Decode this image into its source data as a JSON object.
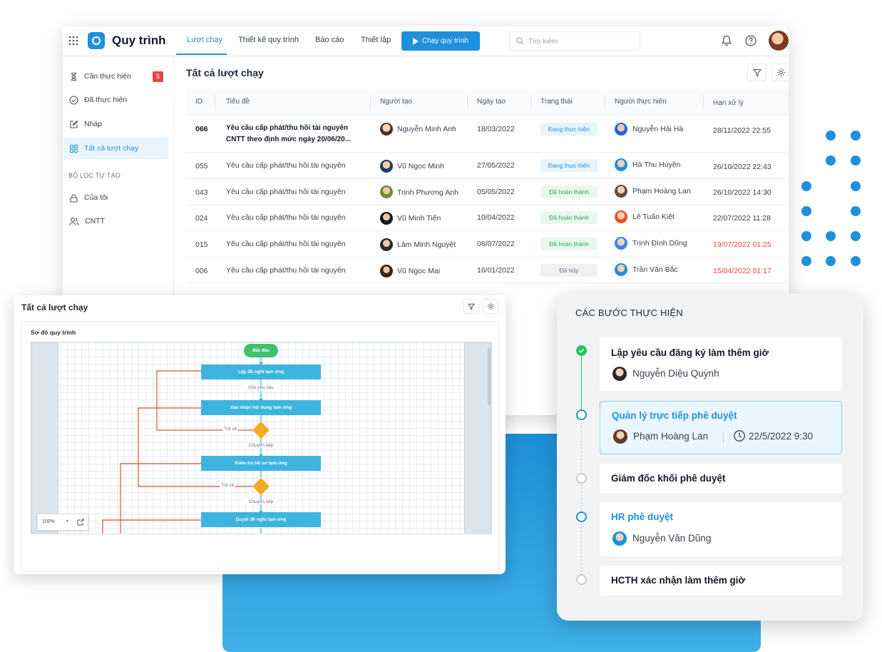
{
  "app": {
    "title": "Quy trình",
    "nav_tabs": [
      {
        "label": "Lượt chạy"
      },
      {
        "label": "Thiết kế quy trình"
      },
      {
        "label": "Báo cáo"
      },
      {
        "label": "Thiết lập"
      }
    ],
    "run_button": "Chạy quy trình",
    "search_placeholder": "Tìm kiếm"
  },
  "sidebar": {
    "items": [
      {
        "label": "Cần thực hiện",
        "badge": "5"
      },
      {
        "label": "Đã thực hiện"
      },
      {
        "label": "Nháp"
      },
      {
        "label": "Tất cả lượt chạy"
      }
    ],
    "section_label": "BỘ LỌC TỰ TẠO",
    "filters": [
      {
        "label": "Của tôi"
      },
      {
        "label": "CNTT"
      }
    ]
  },
  "main": {
    "title": "Tất cả lượt chạy",
    "columns": [
      "ID",
      "Tiêu đề",
      "Người tạo",
      "Ngày tạo",
      "Trạng thái",
      "Người thực hiện",
      "Hạn xử lý"
    ],
    "rows": [
      {
        "id": "066",
        "title": "Yêu cầu cấp phát/thu hồi tài nguyên",
        "title2": "CNTT theo định mức ngày 20/06/20...",
        "creator": "Nguyễn Minh Anh",
        "date": "18/03/2022",
        "status": "Đang thực hiện",
        "assignee": "Nguyễn Hải Hà",
        "deadline": "28/11/2022 22:55"
      },
      {
        "id": "055",
        "title": "Yêu cầu cấp phát/thu hồi tài nguyên",
        "creator": "Vũ Ngọc Minh",
        "date": "27/05/2022",
        "status": "Đang thực hiện",
        "assignee": "Hà Thu Huyền",
        "deadline": "26/10/2022 22:43"
      },
      {
        "id": "043",
        "title": "Yêu cầu cấp phát/thu hồi tài nguyên",
        "creator": "Trịnh Phương Anh",
        "date": "05/05/2022",
        "status": "Đã hoàn thành",
        "assignee": "Phạm Hoàng Lan",
        "deadline": "26/10/2022 14:30"
      },
      {
        "id": "024",
        "title": "Yêu cầu cấp phát/thu hồi tài nguyên",
        "creator": "Vũ Minh Tiến",
        "date": "10/04/2022",
        "status": "Đã hoàn thành",
        "assignee": "Lê Tuấn Kiệt",
        "deadline": "22/07/2022 11:28"
      },
      {
        "id": "015",
        "title": "Yêu cầu cấp phát/thu hồi tài nguyên",
        "creator": "Lâm Minh Nguyệt",
        "date": "06/07/2022",
        "status": "Đã hoàn thành",
        "assignee": "Trịnh Đình Dũng",
        "deadline": "19/07/2022 01:25"
      },
      {
        "id": "006",
        "title": "Yêu cầu cấp phát/thu hồi tài nguyên",
        "creator": "Vũ Ngọc Mai",
        "date": "16/01/2022",
        "status": "Đã hủy",
        "assignee": "Trần Văn Bắc",
        "deadline": "15/04/2022 01:17"
      }
    ]
  },
  "diagram": {
    "title": "Tất cả lượt chạy",
    "subtitle": "Sơ đồ quy trình",
    "nodes": {
      "start": "Bắt đầu",
      "step1": "Lập đề nghị tạm ứng",
      "edge1": "Gửi yêu cầu",
      "step2": "Xác nhận nội dung tạm ứng",
      "return1": "Trả về",
      "forward1": "Chuyển tiếp",
      "step3": "Kiểm tra hồ sơ tạm ứng",
      "return2": "Trả về",
      "forward2": "Chuyển tiếp",
      "step4": "Duyệt đề nghị tạm ứng"
    },
    "zoom": "100%"
  },
  "steps": {
    "title": "CÁC BƯỚC THỰC HIỆN",
    "items": [
      {
        "name": "Lập yêu cầu đăng ký làm thêm giờ",
        "person": "Nguyễn Diệu Quỳnh"
      },
      {
        "name": "Quản lý trực tiếp phê duyệt",
        "person": "Phạm Hoàng Lan",
        "time": "22/5/2022 9:30"
      },
      {
        "name": "Giám đốc khối phê duyệt"
      },
      {
        "name": "HR phê duyệt",
        "person": "Nguyễn Văn Dũng"
      },
      {
        "name": "HCTH xác nhận làm thêm giờ"
      }
    ]
  },
  "colors": {
    "accent": "#1e90dc",
    "success": "#22c55e",
    "danger": "#ef4444",
    "warning_node": "#f7a928",
    "flow_node": "#3db4e0",
    "return_line": "#e2503a"
  }
}
